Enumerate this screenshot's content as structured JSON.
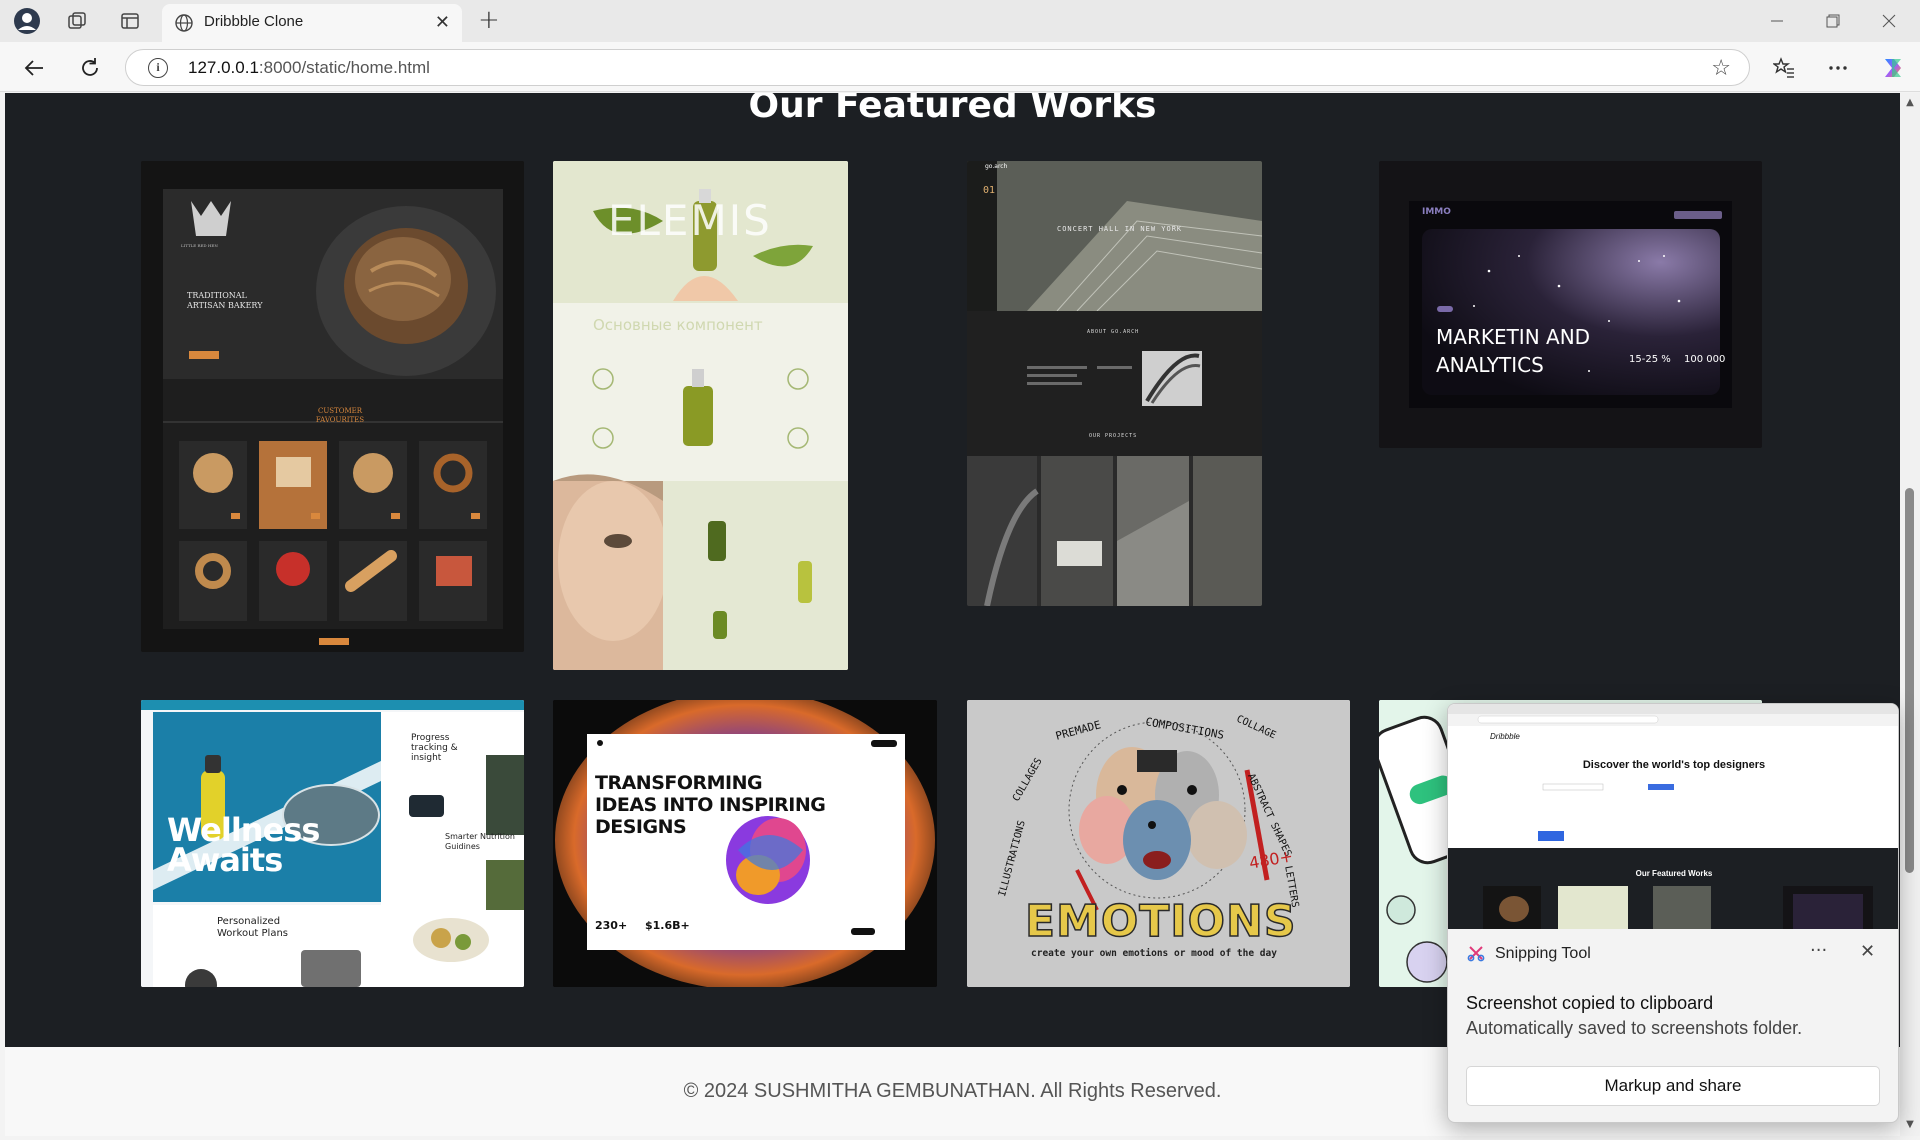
{
  "browser": {
    "tab_title": "Dribbble Clone",
    "new_tab": "+",
    "url_host": "127.0.0.1",
    "url_path": ":8000/static/home.html"
  },
  "page": {
    "featured_title": "Our Featured Works",
    "footer": "© 2024 SUSHMITHA GEMBUNATHAN. All Rights Reserved.",
    "cards": {
      "bakery": {
        "heading": "TRADITIONAL ARTISAN BAKERY",
        "section": "CUSTOMER FAVOURITES",
        "logo": "LITTLE RED HEN"
      },
      "elemis": {
        "brand": "ELEMIS",
        "tagline": "Основные компонент"
      },
      "arch": {
        "hero": "CONCERT HALL IN NEW YORK",
        "section1": "ABOUT GO.ARCH",
        "section2": "OUR PROJECTS",
        "number": "01",
        "logo": "go.arch"
      },
      "immo": {
        "brand": "IMMO",
        "headline1": "MARKETIN AND",
        "headline2": "ANALYTICS",
        "stat1": "15-25 %",
        "stat2": "100 000"
      },
      "wellness": {
        "headline1": "Wellness",
        "headline2": "Awaits",
        "item1": "Progress tracking & insight",
        "item2": "Smarter Nutrition Guidines",
        "item3": "Personalized Workout Plans"
      },
      "transform": {
        "headline1": "TRANSFORMING",
        "headline2": "IDEAS INTO INSPIRING",
        "headline3": "DESIGNS",
        "stat1": "230+",
        "stat2": "$1.6B+"
      },
      "emotions": {
        "title": "EMOTIONS",
        "subtitle": "create your own emotions or mood of the day",
        "words": [
          "PREMADE",
          "COMPOSITIONS",
          "COLLAGE",
          "ABSTRACT SHAPES",
          "LETTERS",
          "ILLUSTRATIONS",
          "COLLAGES",
          "480+"
        ]
      }
    }
  },
  "toast": {
    "app_name": "Snipping Tool",
    "heading": "Screenshot copied to clipboard",
    "sub": "Automatically saved to screenshots folder.",
    "button": "Markup and share",
    "preview_title": "Discover the world's top designers",
    "preview_featured": "Our Featured Works",
    "preview_logo": "Dribbble"
  }
}
